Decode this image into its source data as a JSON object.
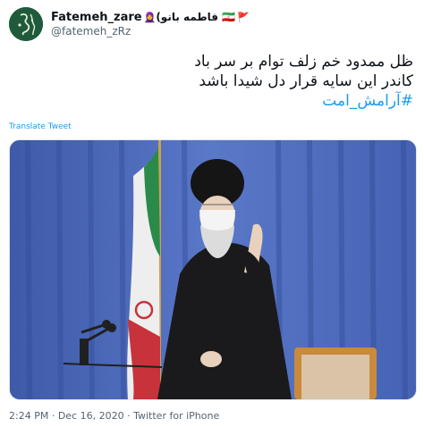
{
  "author": {
    "display_name": "Fatemeh_zare",
    "name_suffix_emoji": "🧕",
    "name_parenthetical": "(فاطمه بانو 🇮🇷",
    "name_flag": "🚩",
    "handle": "@fatemeh_zRz"
  },
  "tweet": {
    "line1": "ظل ممدود خم زلف توام بر سر باد",
    "line2": "کاندر این سایه قرار دل شیدا باشد",
    "hashtag": "#آرامش_امت"
  },
  "translate_label": "Translate Tweet",
  "meta": {
    "time": "2:24 PM",
    "separator": " · ",
    "date": "Dec 16, 2020",
    "client": "Twitter for iPhone"
  },
  "colors": {
    "link": "#1d9bf0",
    "secondary_text": "#536471",
    "avatar_bg": "#1f5a3c"
  },
  "icons": {
    "avatar": "green-calligraphy-avatar"
  }
}
